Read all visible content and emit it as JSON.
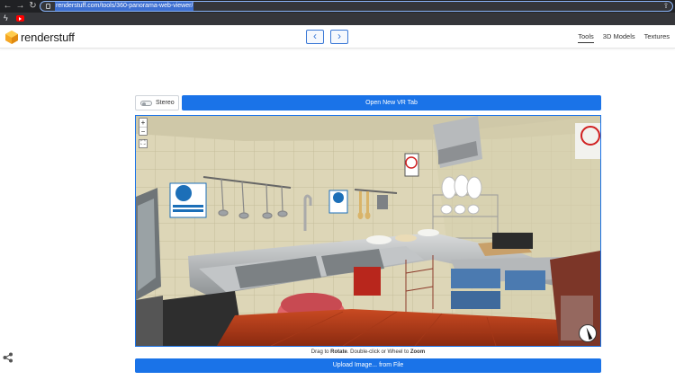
{
  "browser": {
    "url": "renderstuff.com/tools/360-panorama-web-viewer/",
    "back_icon": "back-arrow-icon",
    "forward_icon": "forward-arrow-icon",
    "reload_icon": "reload-icon"
  },
  "bookmarks": {
    "items": [
      "bolt-bookmark-icon",
      "youtube-bookmark-icon"
    ]
  },
  "header": {
    "logo_text": "renderstuff",
    "prev_label": "‹",
    "next_label": "›",
    "nav": [
      {
        "label": "Tools",
        "active": true
      },
      {
        "label": "3D Models",
        "active": false
      },
      {
        "label": "Textures",
        "active": false
      }
    ]
  },
  "controls": {
    "stereo_label": "Stereo",
    "stereo_on": false,
    "vr_button": "Open New VR Tab"
  },
  "viewer": {
    "zoom_in": "+",
    "zoom_out": "−",
    "fullscreen": "⛶",
    "hint_prefix": "Drag to ",
    "hint_rotate": "Rotate",
    "hint_mid": ". Double-click or Wheel to ",
    "hint_zoom": "Zoom",
    "scene": "360-degree panorama of a commercial kitchen with stainless steel sinks and white tiled walls"
  },
  "upload": {
    "label": "Upload Image... from File"
  },
  "colors": {
    "accent": "#1a73e8",
    "chrome_dark": "#202124",
    "logo_orange": "#f5a623"
  }
}
